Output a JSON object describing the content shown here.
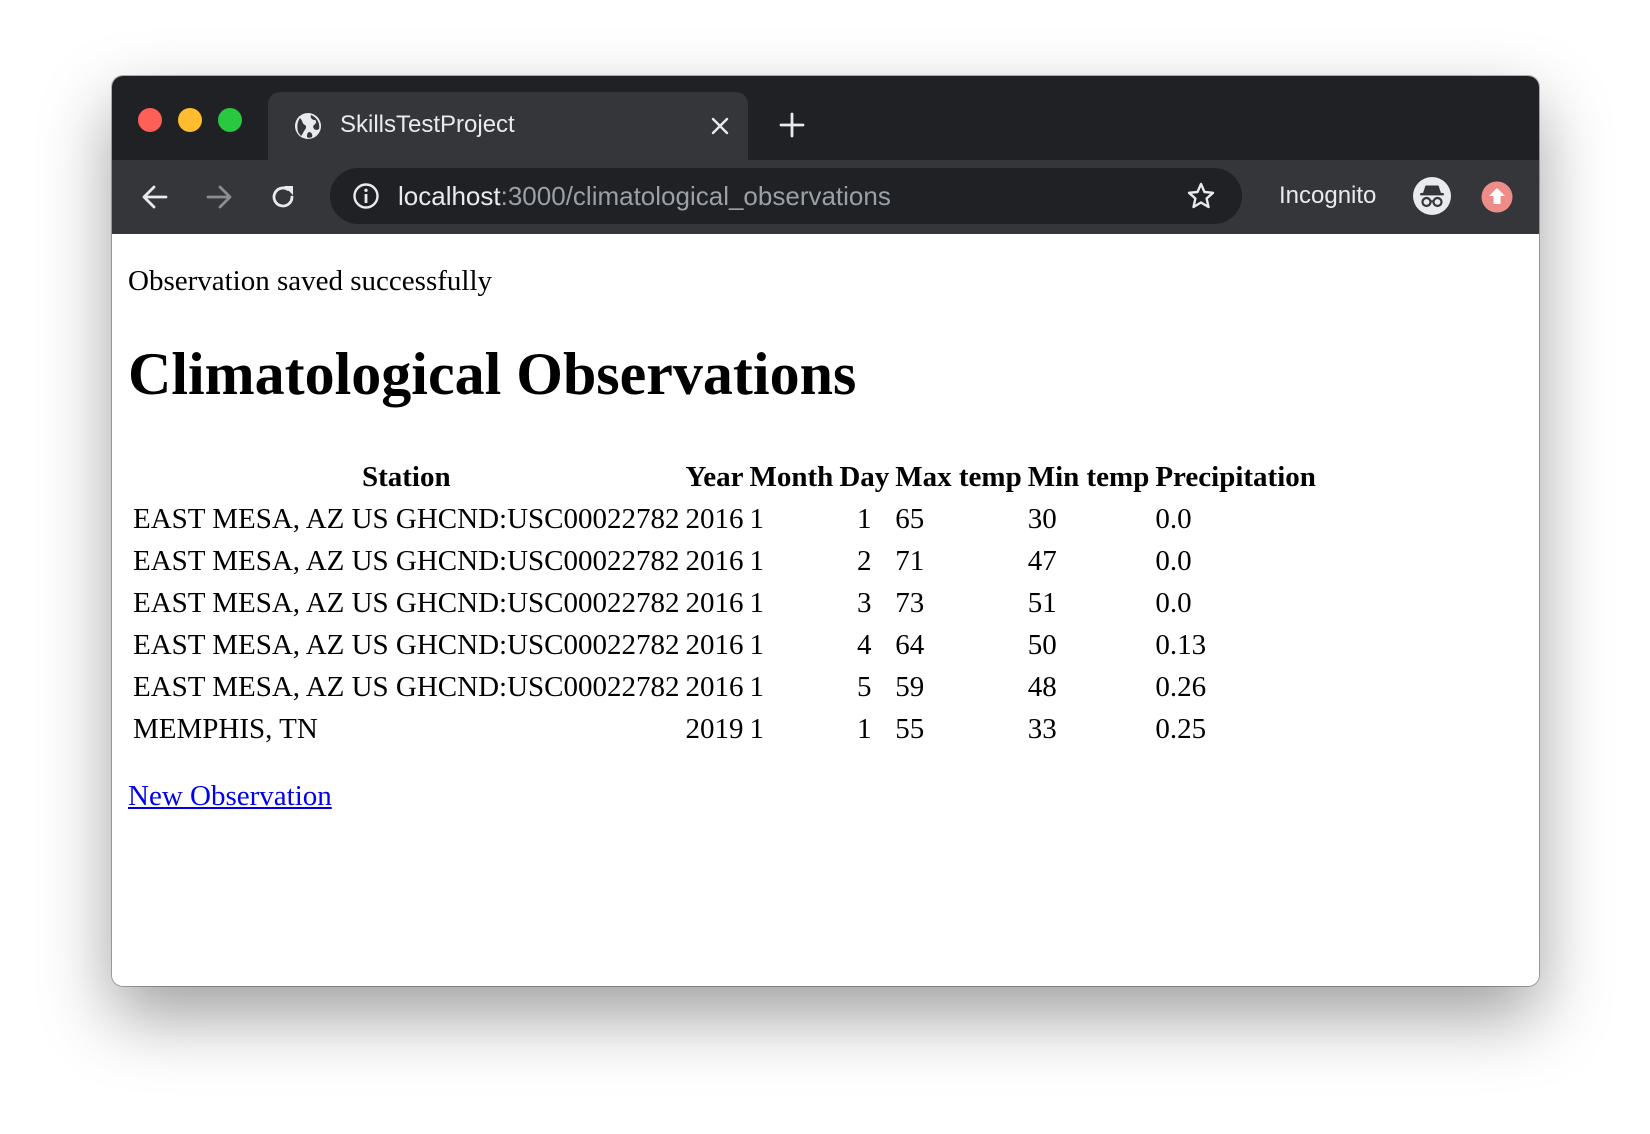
{
  "browser": {
    "tab_title": "SkillsTestProject",
    "url_host": "localhost",
    "url_path": ":3000/climatological_observations",
    "incognito_label": "Incognito"
  },
  "page": {
    "notice": "Observation saved successfully",
    "title": "Climatological Observations",
    "new_link": "New Observation"
  },
  "table": {
    "headers": [
      "Station",
      "Year",
      "Month",
      "Day",
      "Max temp",
      "Min temp",
      "Precipitation"
    ],
    "rows": [
      [
        "EAST MESA, AZ US GHCND:USC00022782",
        "2016",
        "1",
        "1",
        "65",
        "30",
        "0.0"
      ],
      [
        "EAST MESA, AZ US GHCND:USC00022782",
        "2016",
        "1",
        "2",
        "71",
        "47",
        "0.0"
      ],
      [
        "EAST MESA, AZ US GHCND:USC00022782",
        "2016",
        "1",
        "3",
        "73",
        "51",
        "0.0"
      ],
      [
        "EAST MESA, AZ US GHCND:USC00022782",
        "2016",
        "1",
        "4",
        "64",
        "50",
        "0.13"
      ],
      [
        "EAST MESA, AZ US GHCND:USC00022782",
        "2016",
        "1",
        "5",
        "59",
        "48",
        "0.26"
      ],
      [
        "MEMPHIS, TN",
        "2019",
        "1",
        "1",
        "55",
        "33",
        "0.25"
      ]
    ]
  },
  "icons": {
    "tab_favicon": "globe-icon",
    "tab_close": "close-icon",
    "new_tab": "plus-icon",
    "back": "arrow-left-icon",
    "forward": "arrow-right-icon",
    "reload": "reload-icon",
    "site_info": "info-icon",
    "bookmark": "star-icon",
    "incognito": "incognito-icon",
    "update": "update-icon"
  },
  "colors": {
    "traffic_red": "#fe5f57",
    "traffic_yellow": "#febc2e",
    "traffic_green": "#29c840",
    "link": "#0000ee",
    "update_badge": "#ee8c8a"
  }
}
